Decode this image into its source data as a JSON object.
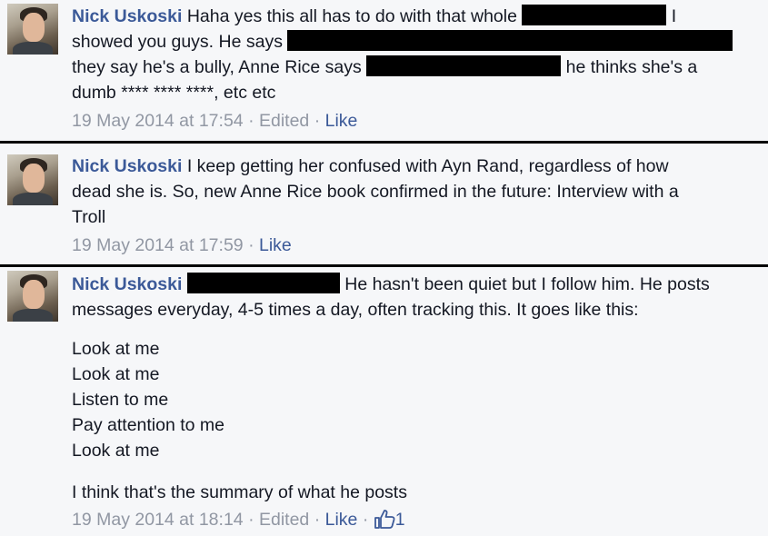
{
  "comments": [
    {
      "author": "Nick Uskoski",
      "line1": "Haha yes this all has to do with that whole",
      "line1b": "I",
      "line2": "showed you guys. He says",
      "line3a": "they say he's a bully, Anne Rice says",
      "line3b": "he thinks she's a",
      "line4": "dumb **** **** ****, etc etc",
      "time": "19 May 2014 at 17:54",
      "edited": "Edited",
      "like": "Like"
    },
    {
      "author": "Nick Uskoski",
      "line1": "I keep getting her confused with Ayn Rand, regardless of how",
      "line2": "dead she is. So, new Anne Rice book confirmed in the future: Interview with a",
      "line3": "Troll",
      "time": "19 May 2014 at 17:59",
      "like": "Like"
    },
    {
      "author": "Nick Uskoski",
      "line1": "He hasn't been quiet but I follow him. He posts",
      "line2": "messages everyday, 4-5 times a day, often tracking this. It goes like this:",
      "list": [
        "Look at me",
        "Look at me",
        "Listen to me",
        "Pay attention to me",
        "Look at me"
      ],
      "summary": "I think that's the summary of what he posts",
      "time": "19 May 2014 at 18:14",
      "edited": "Edited",
      "like": "Like",
      "like_count": "1"
    }
  ],
  "meta_separator": "·",
  "colors": {
    "author": "#3b5998",
    "meta": "#9197a3",
    "background": "#f6f7f9",
    "redaction": "#000000"
  },
  "icons": {
    "avatar": "profile-photo",
    "like_count": "thumbs-up-icon"
  }
}
